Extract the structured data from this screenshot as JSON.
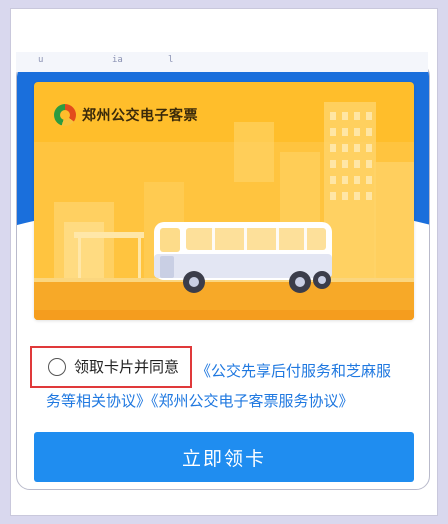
{
  "status_bar": {
    "fragments": [
      "u",
      "ia",
      "l"
    ]
  },
  "card": {
    "title": "郑州公交电子客票",
    "logo_icon": "zhengzhou-bus-logo-icon",
    "illustration": "bus-city-illustration",
    "background_color": "#ffbe2b"
  },
  "agreement": {
    "checkbox_label": "领取卡片并同意",
    "checked": false,
    "link_part1": "《公交先享后付服务和芝麻服",
    "link_part2": "务等相关协议》《郑州公交电子客票服务协议》"
  },
  "primary_button": {
    "label": "立即领卡"
  },
  "colors": {
    "accent_blue": "#1f8df0",
    "link_blue": "#1f78e0",
    "highlight_red": "#e0393a",
    "header_blue": "#1a6fdc"
  }
}
